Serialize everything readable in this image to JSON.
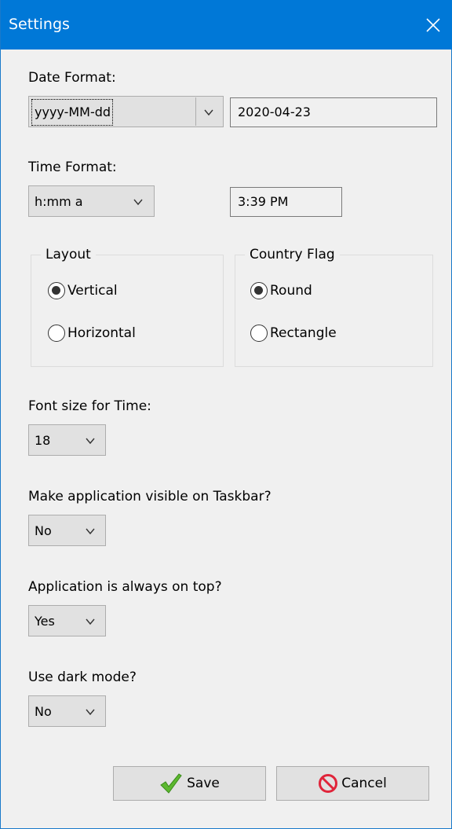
{
  "window": {
    "title": "Settings",
    "close_icon": "close-icon",
    "accent": "#0078d7"
  },
  "date_format": {
    "label": "Date Format:",
    "selected": "yyyy-MM-dd",
    "preview": "2020-04-23"
  },
  "time_format": {
    "label": "Time Format:",
    "selected": "h:mm a",
    "preview": "3:39 PM"
  },
  "layout_group": {
    "title": "Layout",
    "options": [
      {
        "label": "Vertical",
        "checked": true
      },
      {
        "label": "Horizontal",
        "checked": false
      }
    ]
  },
  "flag_group": {
    "title": "Country Flag",
    "options": [
      {
        "label": "Round",
        "checked": true
      },
      {
        "label": "Rectangle",
        "checked": false
      }
    ]
  },
  "font_size": {
    "label": "Font size for Time:",
    "selected": "18"
  },
  "taskbar": {
    "label": "Make application visible on Taskbar?",
    "selected": "No"
  },
  "always_on_top": {
    "label": "Application is always on top?",
    "selected": "Yes"
  },
  "dark_mode": {
    "label": "Use dark mode?",
    "selected": "No"
  },
  "buttons": {
    "save_label": "Save",
    "save_icon": "checkmark-icon",
    "cancel_label": "Cancel",
    "cancel_icon": "no-entry-icon"
  }
}
